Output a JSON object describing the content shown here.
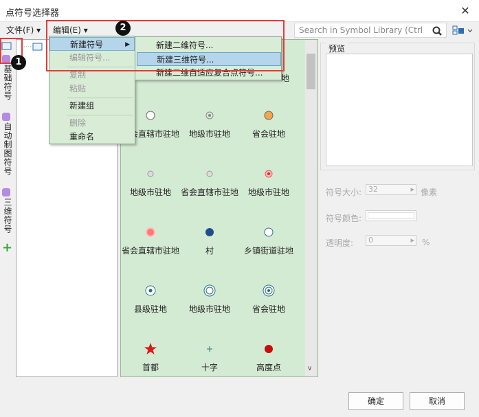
{
  "window": {
    "title": "点符号选择器",
    "close_glyph": "✕"
  },
  "menubar": {
    "file": "文件(F) ▾",
    "edit": "编辑(E) ▾"
  },
  "search": {
    "placeholder": "Search in Symbol Library (Ctrl"
  },
  "left_tabs": [
    {
      "label": "基础符号",
      "icon": "folder-icon"
    },
    {
      "label": "自动制图符号",
      "icon": "auto-map-icon"
    },
    {
      "label": "三维符号",
      "icon": "3d-icon"
    }
  ],
  "grid_partial_label": "地",
  "symbols": [
    {
      "label": "省会直辖市驻地",
      "shape": "circle-hollow"
    },
    {
      "label": "地级市驻地",
      "shape": "circle-dot-gray"
    },
    {
      "label": "省会驻地",
      "shape": "circle-orange"
    },
    {
      "label": "地级市驻地",
      "shape": "circle-small-gray"
    },
    {
      "label": "省会直辖市驻地",
      "shape": "circle-small-gray"
    },
    {
      "label": "地级市驻地",
      "shape": "circle-red-dot"
    },
    {
      "label": "省会直辖市驻地",
      "shape": "circle-red"
    },
    {
      "label": "村",
      "shape": "circle-blue"
    },
    {
      "label": "乡镇街道驻地",
      "shape": "circle-hollow-teal"
    },
    {
      "label": "县级驻地",
      "shape": "target-dot"
    },
    {
      "label": "地级市驻地",
      "shape": "target-double"
    },
    {
      "label": "省会驻地",
      "shape": "target-triple"
    },
    {
      "label": "首都",
      "shape": "star-red"
    },
    {
      "label": "十字",
      "shape": "cross"
    },
    {
      "label": "高度点",
      "shape": "dot-red"
    }
  ],
  "preview": {
    "title": "预览",
    "size_label": "符号大小:",
    "size_value": "32",
    "size_unit": "像素",
    "color_label": "符号颜色:",
    "opacity_label": "透明度:",
    "opacity_value": "0",
    "opacity_unit": "%"
  },
  "buttons": {
    "ok": "确定",
    "cancel": "取消"
  },
  "edit_menu": {
    "items": [
      {
        "label": "新建符号",
        "state": "highlighted",
        "submenu": true
      },
      {
        "label": "编辑符号...",
        "state": "disabled"
      },
      {
        "label": "复制",
        "state": "disabled"
      },
      {
        "label": "粘贴",
        "state": "disabled"
      },
      {
        "label": "新建组",
        "state": "normal"
      },
      {
        "label": "删除",
        "state": "disabled"
      },
      {
        "label": "重命名",
        "state": "normal"
      }
    ],
    "submenu": [
      {
        "label": "新建二维符号...",
        "state": "normal"
      },
      {
        "label": "新建三维符号...",
        "state": "highlighted"
      },
      {
        "label": "新建二维自适应复合点符号...",
        "state": "normal"
      }
    ]
  },
  "callouts": [
    "1",
    "2"
  ],
  "colors": {
    "grid_bg": "#d4ebd3",
    "menu_bg": "#d8ecd6",
    "highlight": "#b5d6ea",
    "callout_red": "#e33b3b"
  }
}
